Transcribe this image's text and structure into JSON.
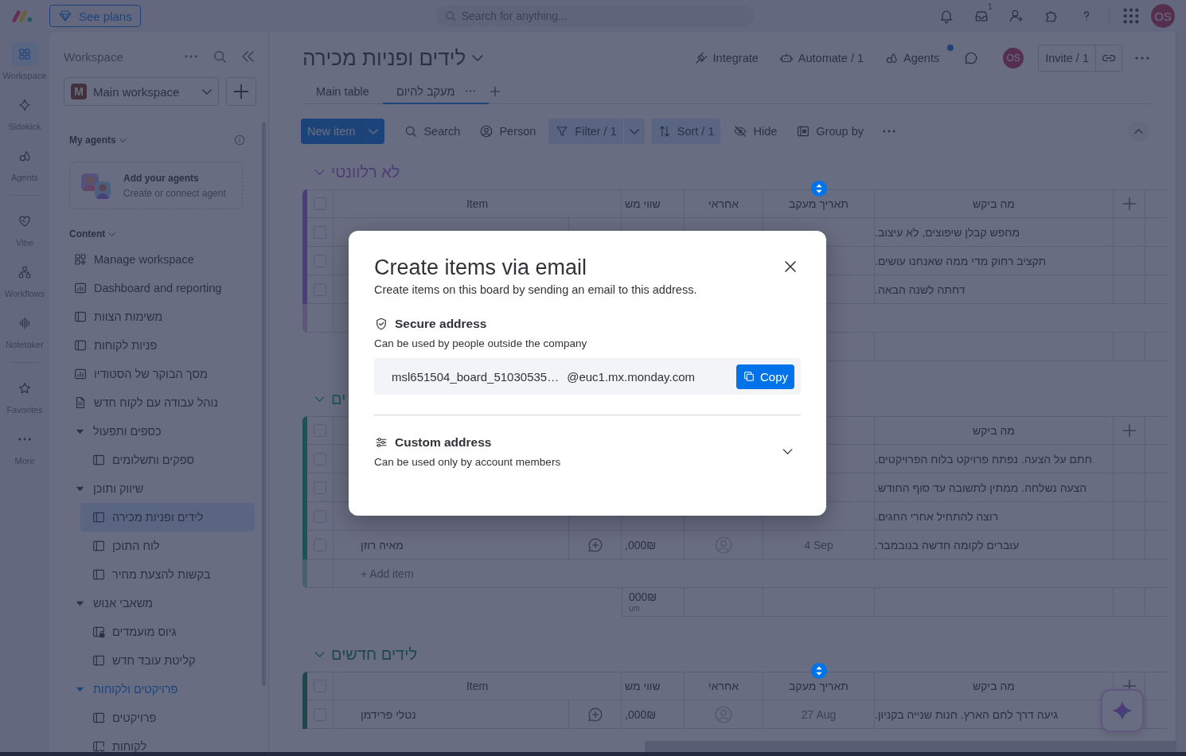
{
  "topbar": {
    "plans_button": "See plans",
    "search": {
      "placeholder": "Search for anything..."
    },
    "inbox_badge": "1",
    "avatar": "OS"
  },
  "rail": [
    {
      "kind": "workspace",
      "label": "Workspace",
      "selected": true,
      "separated": false
    },
    {
      "kind": "sidekick",
      "label": "Sidekick",
      "selected": false,
      "separated": false
    },
    {
      "kind": "agents",
      "label": "Agents",
      "selected": false,
      "separated": false
    },
    {
      "kind": "vibe",
      "label": "Vibe",
      "selected": false,
      "separated": true
    },
    {
      "kind": "workflows",
      "label": "Workflows",
      "selected": false,
      "separated": false
    },
    {
      "kind": "notetaker",
      "label": "Notetaker",
      "selected": false,
      "separated": false
    },
    {
      "kind": "favorites",
      "label": "Favorites",
      "selected": false,
      "separated": true
    },
    {
      "kind": "more",
      "label": "More",
      "selected": false,
      "separated": false
    }
  ],
  "sidebar": {
    "title": "Workspace",
    "workspace": {
      "initial": "M",
      "name": "Main workspace"
    },
    "agents_heading": "My agents",
    "agents_card": {
      "title": "Add your agents",
      "subtitle": "Create or connect agent"
    },
    "content_heading": "Content",
    "items": [
      {
        "kind": "manage",
        "label": "Manage workspace",
        "selected": false
      },
      {
        "kind": "dashboard",
        "label": "Dashboard and reporting",
        "selected": false
      },
      {
        "kind": "board",
        "label": "משימות הצוות",
        "selected": false
      },
      {
        "kind": "board",
        "label": "פניות לקוחות",
        "selected": false
      },
      {
        "kind": "dashboard",
        "label": "מסך הבוקר של הסטודיו",
        "selected": false
      },
      {
        "kind": "doc",
        "label": "נוהל עבודה עם לקוח חדש",
        "selected": false
      },
      {
        "kind": "folder",
        "label": "כספים ותפעול",
        "expanded": true,
        "active": false,
        "children": [
          {
            "kind": "board",
            "label": "ספקים ותשלומים",
            "selected": false
          }
        ]
      },
      {
        "kind": "folder",
        "label": "שיווק ותוכן",
        "expanded": true,
        "active": false,
        "children": [
          {
            "kind": "board",
            "label": "לידים ופניות מכירה",
            "selected": true
          },
          {
            "kind": "board",
            "label": "לוח התוכן",
            "selected": false
          },
          {
            "kind": "board",
            "label": "בקשות להצעת מחיר",
            "selected": false
          }
        ]
      },
      {
        "kind": "folder",
        "label": "משאבי אנוש",
        "expanded": true,
        "active": false,
        "children": [
          {
            "kind": "private_board",
            "label": "גיוס מועמדים",
            "selected": false
          },
          {
            "kind": "board",
            "label": "קליטת עובד חדש",
            "selected": false
          }
        ]
      },
      {
        "kind": "folder",
        "label": "פרויקטים ולקוחות",
        "expanded": true,
        "active": true,
        "children": [
          {
            "kind": "board",
            "label": "פרויקטים",
            "selected": false
          },
          {
            "kind": "shared_board",
            "label": "לקוחות",
            "selected": false
          }
        ]
      }
    ]
  },
  "board": {
    "title": "לידים ופניות מכירה",
    "actions": [
      {
        "kind": "agents",
        "label": "Agents",
        "notify": true
      },
      {
        "kind": "automate",
        "label": "Automate / 1",
        "notify": false
      },
      {
        "kind": "integrate",
        "label": "Integrate",
        "notify": false
      }
    ],
    "avatar": "OS",
    "invite": "Invite / 1",
    "tabs": [
      {
        "label": "מעקב להיום",
        "selected": true
      },
      {
        "label": "Main table",
        "selected": false
      }
    ],
    "toolbar": {
      "new_item": "New item",
      "tools": [
        {
          "kind": "group",
          "label": "Group by",
          "active": false
        },
        {
          "kind": "hide",
          "label": "Hide",
          "active": false
        },
        {
          "kind": "sort",
          "label": "Sort / 1",
          "active": true
        },
        {
          "kind": "filter",
          "label": "Filter / 1",
          "active": true
        },
        {
          "kind": "person",
          "label": "Person",
          "active": false
        },
        {
          "kind": "search",
          "label": "Search",
          "active": false
        }
      ]
    }
  },
  "groups": [
    {
      "title": "לא רלוונטי",
      "color": "#4d3d77",
      "select_all": false,
      "columns": [
        {
          "kind": "text",
          "label": "מה ביקש",
          "sorted": false
        },
        {
          "kind": "date",
          "label": "תאריך מעקב",
          "sorted": true
        },
        {
          "kind": "person",
          "label": "אחראי",
          "sorted": false
        },
        {
          "kind": "money",
          "label": "שווי מש",
          "sorted": false
        },
        {
          "kind": "item",
          "label": "Item",
          "sorted": false
        }
      ],
      "rows": [
        {
          "checked": false,
          "request": "מחפש קבלן שיפוצים, לא עיצוב."
        },
        {
          "checked": false,
          "request": "תקציב רחוק מדי ממה שאנחנו עושים."
        },
        {
          "checked": false,
          "request": "דחתה לשנה הבאה."
        }
      ]
    },
    {
      "title": "ים",
      "color": "#1d5355",
      "select_all": false,
      "columns": [
        {
          "kind": "text",
          "label": "מה ביקש",
          "sorted": false
        }
      ],
      "rows": [
        {
          "checked": false,
          "request": "חתם על הצעה. נפתח פרויקט בלוח הפרויקטים."
        },
        {
          "checked": false,
          "request": "הצעה נשלחה. ממתין לתשובה עד סוף החודש."
        },
        {
          "checked": false,
          "request": "רוצה להתחיל אחרי החגים."
        },
        {
          "checked": false,
          "item": "מאיה רוזן",
          "money": ",000₪",
          "date": "4 Sep",
          "request": "עוברים לקומה חדשה בנובמבר."
        }
      ],
      "footer": {
        "add_item": "+ Add item",
        "sum": "000₪",
        "sum_caption": "um"
      }
    },
    {
      "title": "לידים חדשים",
      "color": "#1e474c",
      "select_all": false,
      "columns": [
        {
          "kind": "text",
          "label": "מה ביקש",
          "sorted": false
        },
        {
          "kind": "date",
          "label": "תאריך מעקב",
          "sorted": true
        },
        {
          "kind": "person",
          "label": "אחראי",
          "sorted": false
        },
        {
          "kind": "money",
          "label": "שווי מש",
          "sorted": false
        },
        {
          "kind": "item",
          "label": "Item",
          "sorted": false
        }
      ],
      "rows": [
        {
          "checked": false,
          "item": "נטלי פרידמן",
          "money": ",000₪",
          "date": "27 Aug",
          "request": "גיעה דרך לחם הארץ. חנות שנייה בקניון."
        }
      ]
    }
  ],
  "modal": {
    "title": "Create items via email",
    "subtitle": "Create items on this board by sending an email to this address.",
    "sections": [
      {
        "kind": "secure",
        "title": "Secure address",
        "subtitle": "Can be used by people outside the company",
        "address": "msl651504_board_51030535…",
        "domain": "@euc1.mx.monday.com",
        "copy": "Copy"
      },
      {
        "kind": "custom",
        "title": "Custom address",
        "subtitle": "Can be used only by account members",
        "expanded": false
      }
    ]
  }
}
